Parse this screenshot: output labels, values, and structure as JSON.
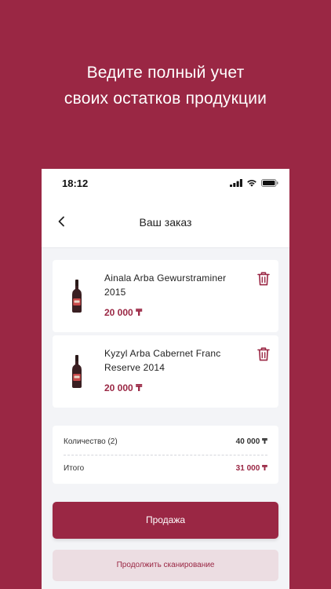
{
  "headline": {
    "line1": "Ведите полный учет",
    "line2": "своих остатков продукции"
  },
  "status_bar": {
    "time": "18:12",
    "icons": [
      "signal-icon",
      "wifi-icon",
      "battery-icon"
    ]
  },
  "nav": {
    "title": "Ваш заказ",
    "back_icon": "chevron-left-icon"
  },
  "order_items": [
    {
      "name": "Ainala Arba Gewurstraminer 2015",
      "price": "20 000 ₸",
      "icon": "wine-bottle-icon",
      "delete_icon": "trash-icon"
    },
    {
      "name": "Kyzyl Arba Cabernet Franc Reserve 2014",
      "price": "20 000 ₸",
      "icon": "wine-bottle-icon",
      "delete_icon": "trash-icon"
    }
  ],
  "summary": {
    "quantity_label": "Количество (2)",
    "quantity_value": "40 000 ₸",
    "total_label": "Итого",
    "total_value": "31 000 ₸"
  },
  "actions": {
    "sell_label": "Продажа",
    "continue_scan_label": "Продолжить сканирование"
  },
  "colors": {
    "brand": "#9a2744",
    "background_screen": "#f3f4f7",
    "secondary_button_bg": "#ecdde2"
  }
}
